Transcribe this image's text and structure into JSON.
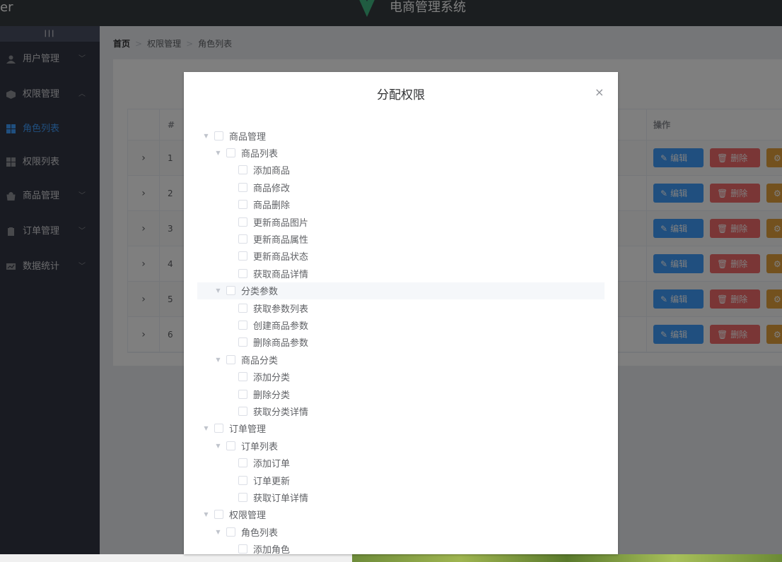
{
  "header": {
    "brand_fragment": "er",
    "title": "电商管理系统"
  },
  "sidebar": {
    "toggle": "|||",
    "menus": [
      {
        "label": "用户管理",
        "icon": "user-icon"
      },
      {
        "label": "权限管理",
        "icon": "box-icon",
        "expanded": true,
        "children": [
          {
            "label": "角色列表",
            "active": true
          },
          {
            "label": "权限列表"
          }
        ]
      },
      {
        "label": "商品管理",
        "icon": "bag-icon"
      },
      {
        "label": "订单管理",
        "icon": "clipboard-icon"
      },
      {
        "label": "数据统计",
        "icon": "chart-icon"
      }
    ]
  },
  "breadcrumb": [
    "首页",
    "权限管理",
    "角色列表"
  ],
  "table": {
    "headers": {
      "index": "#",
      "ops": "操作"
    },
    "rows": [
      "1",
      "2",
      "3",
      "4",
      "5",
      "6"
    ],
    "edit_label": "编辑",
    "delete_label": "删除"
  },
  "dialog": {
    "title": "分配权限",
    "close": "×",
    "tree": [
      {
        "label": "商品管理",
        "level": 1,
        "caret": true
      },
      {
        "label": "商品列表",
        "level": 2,
        "caret": true
      },
      {
        "label": "添加商品",
        "level": 3
      },
      {
        "label": "商品修改",
        "level": 3
      },
      {
        "label": "商品删除",
        "level": 3
      },
      {
        "label": "更新商品图片",
        "level": 3
      },
      {
        "label": "更新商品属性",
        "level": 3
      },
      {
        "label": "更新商品状态",
        "level": 3
      },
      {
        "label": "获取商品详情",
        "level": 3
      },
      {
        "label": "分类参数",
        "level": 2,
        "caret": true,
        "highlighted": true
      },
      {
        "label": "获取参数列表",
        "level": 3
      },
      {
        "label": "创建商品参数",
        "level": 3
      },
      {
        "label": "删除商品参数",
        "level": 3
      },
      {
        "label": "商品分类",
        "level": 2,
        "caret": true
      },
      {
        "label": "添加分类",
        "level": 3
      },
      {
        "label": "删除分类",
        "level": 3
      },
      {
        "label": "获取分类详情",
        "level": 3
      },
      {
        "label": "订单管理",
        "level": 1,
        "caret": true
      },
      {
        "label": "订单列表",
        "level": 2,
        "caret": true
      },
      {
        "label": "添加订单",
        "level": 3
      },
      {
        "label": "订单更新",
        "level": 3
      },
      {
        "label": "获取订单详情",
        "level": 3
      },
      {
        "label": "权限管理",
        "level": 1,
        "caret": true
      },
      {
        "label": "角色列表",
        "level": 2,
        "caret": true
      },
      {
        "label": "添加角色",
        "level": 3
      }
    ]
  }
}
